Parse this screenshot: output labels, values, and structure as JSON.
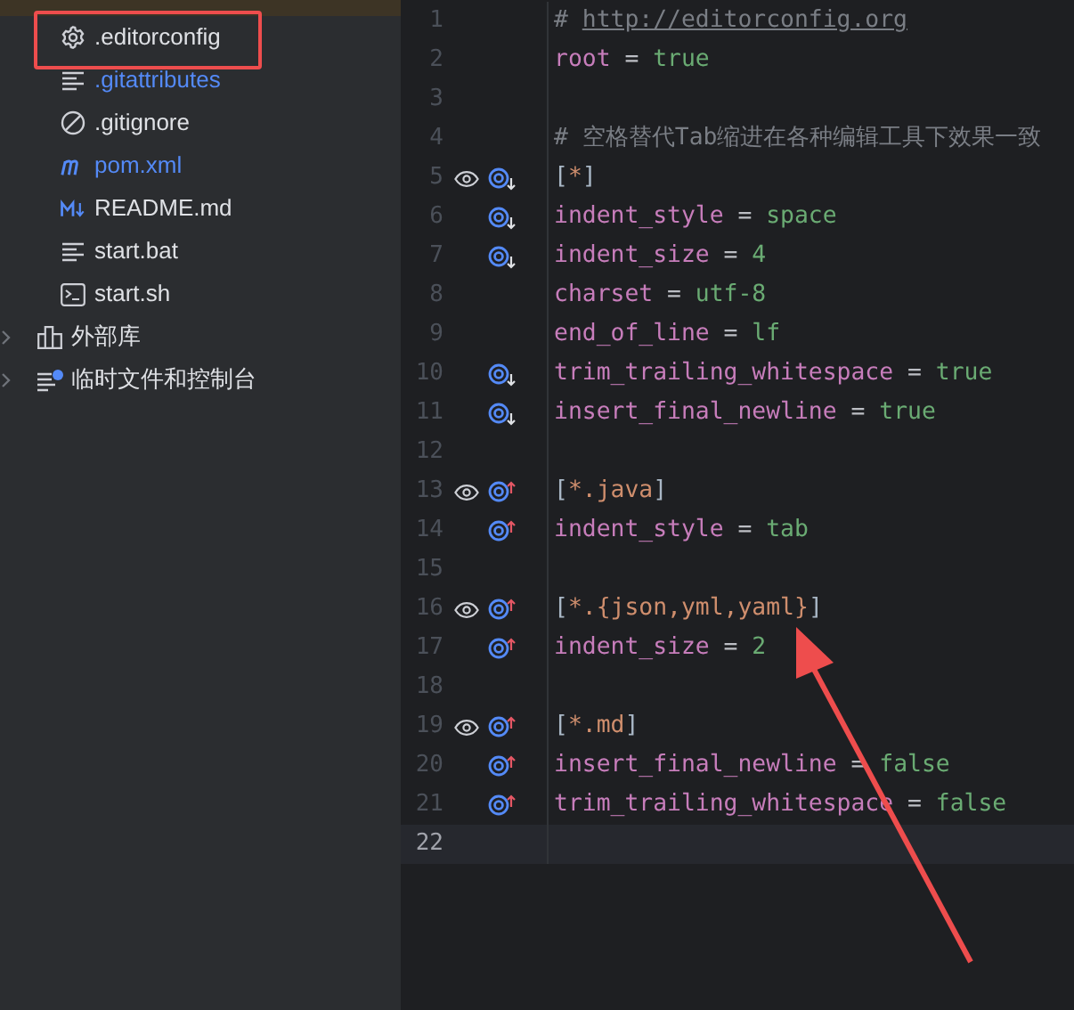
{
  "project_files": [
    {
      "kind": "gear",
      "label": ".editorconfig",
      "color": "#dfe1e5"
    },
    {
      "kind": "lines",
      "label": ".gitattributes",
      "color": "#548af7"
    },
    {
      "kind": "ignore",
      "label": ".gitignore",
      "color": "#dfe1e5"
    },
    {
      "kind": "maven",
      "label": "pom.xml",
      "color": "#548af7"
    },
    {
      "kind": "markdown",
      "label": "README.md",
      "color": "#dfe1e5"
    },
    {
      "kind": "lines",
      "label": "start.bat",
      "color": "#dfe1e5"
    },
    {
      "kind": "terminal",
      "label": "start.sh",
      "color": "#dfe1e5"
    }
  ],
  "top_level_nodes": [
    {
      "kind": "library",
      "label": "外部库",
      "expanded": false
    },
    {
      "kind": "scratch",
      "label": "临时文件和控制台",
      "expanded": false
    }
  ],
  "editor_lines": [
    {
      "number": "1",
      "eye": false,
      "kind": "plain",
      "current": false,
      "tokens": [
        {
          "kind": "comment",
          "text": "# "
        },
        {
          "kind": "link",
          "text": "http://editorconfig.org"
        }
      ]
    },
    {
      "number": "2",
      "eye": false,
      "kind": "plain",
      "current": false,
      "tokens": [
        {
          "kind": "key",
          "text": "root"
        },
        {
          "kind": "op",
          "text": " = "
        },
        {
          "kind": "value",
          "text": "true"
        }
      ]
    },
    {
      "number": "3",
      "eye": false,
      "kind": "plain",
      "current": false
    },
    {
      "number": "4",
      "eye": false,
      "kind": "plain",
      "current": false,
      "tokens": [
        {
          "kind": "comment",
          "text": "# 空格替代Tab缩进在各种编辑工具下效果一致"
        }
      ]
    },
    {
      "number": "5",
      "eye": true,
      "kind": "overridden",
      "current": false,
      "tokens": [
        {
          "kind": "bracket",
          "text": "["
        },
        {
          "kind": "section",
          "text": "*"
        },
        {
          "kind": "bracket",
          "text": "]"
        }
      ]
    },
    {
      "number": "6",
      "eye": false,
      "kind": "overridden",
      "current": false,
      "tokens": [
        {
          "kind": "key",
          "text": "indent_style"
        },
        {
          "kind": "op",
          "text": " = "
        },
        {
          "kind": "value",
          "text": "space"
        }
      ]
    },
    {
      "number": "7",
      "eye": false,
      "kind": "overridden",
      "current": false,
      "tokens": [
        {
          "kind": "key",
          "text": "indent_size"
        },
        {
          "kind": "op",
          "text": " = "
        },
        {
          "kind": "value",
          "text": "4"
        }
      ]
    },
    {
      "number": "8",
      "eye": false,
      "kind": "plain",
      "current": false,
      "tokens": [
        {
          "kind": "key",
          "text": "charset"
        },
        {
          "kind": "op",
          "text": " = "
        },
        {
          "kind": "value",
          "text": "utf-8"
        }
      ]
    },
    {
      "number": "9",
      "eye": false,
      "kind": "plain",
      "current": false,
      "tokens": [
        {
          "kind": "key",
          "text": "end_of_line"
        },
        {
          "kind": "op",
          "text": " = "
        },
        {
          "kind": "value",
          "text": "lf"
        }
      ]
    },
    {
      "number": "10",
      "eye": false,
      "kind": "overridden",
      "current": false,
      "tokens": [
        {
          "kind": "key",
          "text": "trim_trailing_whitespace"
        },
        {
          "kind": "op",
          "text": " = "
        },
        {
          "kind": "value",
          "text": "true"
        }
      ]
    },
    {
      "number": "11",
      "eye": false,
      "kind": "overridden",
      "current": false,
      "tokens": [
        {
          "kind": "key",
          "text": "insert_final_newline"
        },
        {
          "kind": "op",
          "text": " = "
        },
        {
          "kind": "value",
          "text": "true"
        }
      ]
    },
    {
      "number": "12",
      "eye": false,
      "kind": "plain",
      "current": false
    },
    {
      "number": "13",
      "eye": true,
      "kind": "overriding",
      "current": false,
      "tokens": [
        {
          "kind": "bracket",
          "text": "["
        },
        {
          "kind": "section",
          "text": "*.java"
        },
        {
          "kind": "bracket",
          "text": "]"
        }
      ]
    },
    {
      "number": "14",
      "eye": false,
      "kind": "overriding",
      "current": false,
      "tokens": [
        {
          "kind": "key",
          "text": "indent_style"
        },
        {
          "kind": "op",
          "text": " = "
        },
        {
          "kind": "value",
          "text": "tab"
        }
      ]
    },
    {
      "number": "15",
      "eye": false,
      "kind": "plain",
      "current": false
    },
    {
      "number": "16",
      "eye": true,
      "kind": "overriding",
      "current": false,
      "tokens": [
        {
          "kind": "bracket",
          "text": "["
        },
        {
          "kind": "section",
          "text": "*.{json,yml,yaml}"
        },
        {
          "kind": "bracket",
          "text": "]"
        }
      ]
    },
    {
      "number": "17",
      "eye": false,
      "kind": "overriding",
      "current": false,
      "tokens": [
        {
          "kind": "key",
          "text": "indent_size"
        },
        {
          "kind": "op",
          "text": " = "
        },
        {
          "kind": "value",
          "text": "2"
        }
      ]
    },
    {
      "number": "18",
      "eye": false,
      "kind": "plain",
      "current": false
    },
    {
      "number": "19",
      "eye": true,
      "kind": "overriding",
      "current": false,
      "tokens": [
        {
          "kind": "bracket",
          "text": "["
        },
        {
          "kind": "section",
          "text": "*.md"
        },
        {
          "kind": "bracket",
          "text": "]"
        }
      ]
    },
    {
      "number": "20",
      "eye": false,
      "kind": "overriding",
      "current": false,
      "tokens": [
        {
          "kind": "key",
          "text": "insert_final_newline"
        },
        {
          "kind": "op",
          "text": " = "
        },
        {
          "kind": "value",
          "text": "false"
        }
      ]
    },
    {
      "number": "21",
      "eye": false,
      "kind": "overriding",
      "current": false,
      "tokens": [
        {
          "kind": "key",
          "text": "trim_trailing_whitespace"
        },
        {
          "kind": "op",
          "text": " = "
        },
        {
          "kind": "value",
          "text": "false"
        }
      ]
    },
    {
      "number": "22",
      "eye": false,
      "kind": "plain",
      "current": true
    }
  ],
  "annotations": {
    "highlight_box": true,
    "arrow": true
  }
}
